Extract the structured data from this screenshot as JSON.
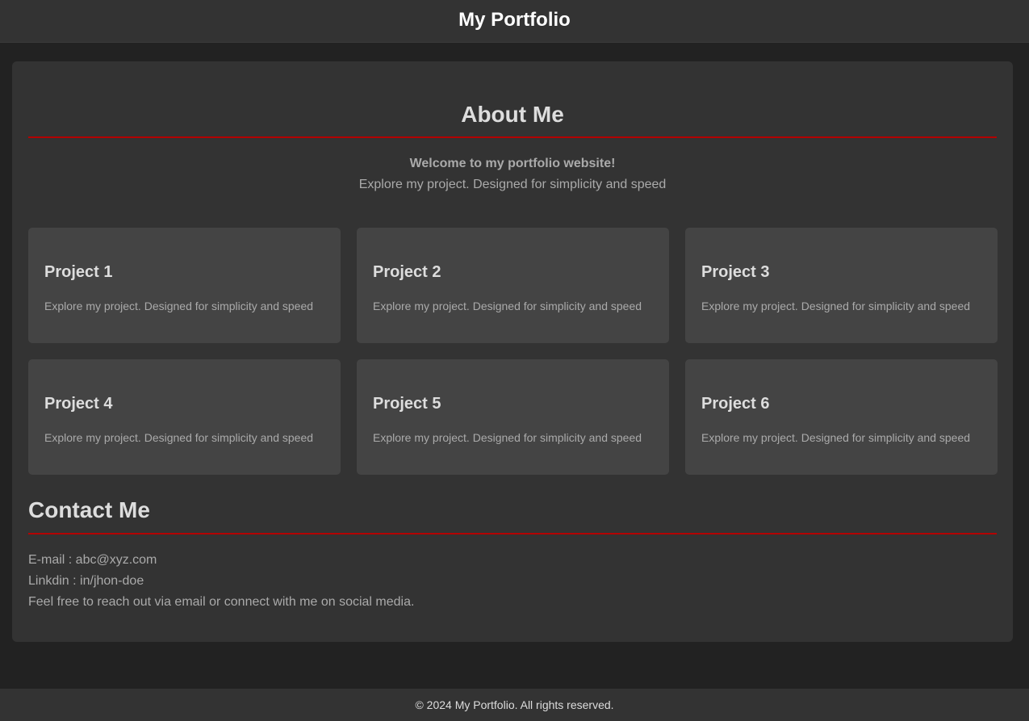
{
  "header": {
    "title": "My Portfolio"
  },
  "about": {
    "title": "About Me",
    "welcome": "Welcome to my portfolio website!",
    "tagline": "Explore my project. Designed for simplicity and speed"
  },
  "projects": [
    {
      "title": "Project 1",
      "description": "Explore my project. Designed for simplicity and speed"
    },
    {
      "title": "Project 2",
      "description": "Explore my project. Designed for simplicity and speed"
    },
    {
      "title": "Project 3",
      "description": "Explore my project. Designed for simplicity and speed"
    },
    {
      "title": "Project 4",
      "description": "Explore my project. Designed for simplicity and speed"
    },
    {
      "title": "Project 5",
      "description": "Explore my project. Designed for simplicity and speed"
    },
    {
      "title": "Project 6",
      "description": "Explore my project. Designed for simplicity and speed"
    }
  ],
  "contact": {
    "title": "Contact Me",
    "email": "E-mail : abc@xyz.com",
    "linkedin": "Linkdin : in/jhon-doe",
    "note": "Feel free to reach out via email or connect with me on social media."
  },
  "footer": {
    "text": "© 2024 My Portfolio. All rights reserved."
  },
  "colors": {
    "background": "#222222",
    "panel": "#333333",
    "card": "#444444",
    "accent": "#b30000",
    "heading": "#dddddd",
    "body_text": "#aaaaaa"
  }
}
